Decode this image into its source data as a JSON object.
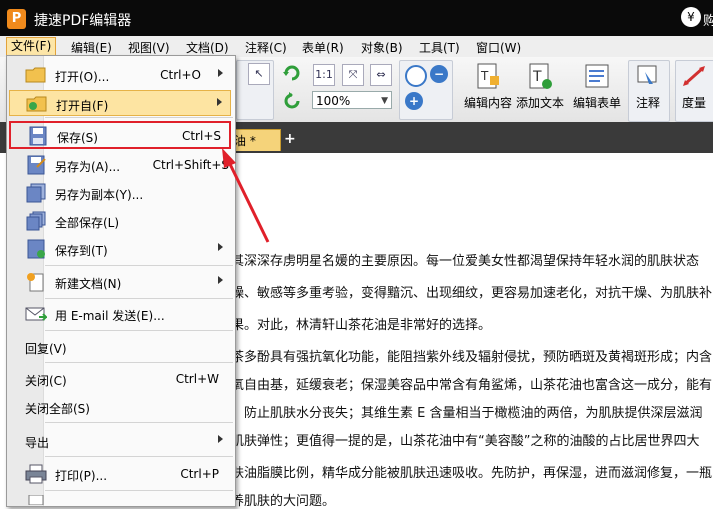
{
  "titlebar": {
    "logo_letter": "P",
    "title": "捷速PDF编辑器",
    "right_text": "购"
  },
  "menubar": {
    "file": "文件(F)",
    "edit": "编辑(E)",
    "view": "视图(V)",
    "document": "文档(D)",
    "comment": "注释(C)",
    "form": "表单(R)",
    "object": "对象(B)",
    "tools": "工具(T)",
    "window": "窗口(W)"
  },
  "toolbar": {
    "zoom_value": "100%",
    "edit_content": "编辑内容",
    "add_text": "添加文本",
    "edit_form": "编辑表单",
    "comment": "注释",
    "measure": "度量"
  },
  "tab": {
    "doc_title": "油 *"
  },
  "file_menu": {
    "open": {
      "label": "打开(O)...",
      "shortcut": "Ctrl+O"
    },
    "open_from": {
      "label": "打开自(F)"
    },
    "save": {
      "label": "保存(S)",
      "shortcut": "Ctrl+S"
    },
    "save_as": {
      "label": "另存为(A)...",
      "shortcut": "Ctrl+Shift+S"
    },
    "save_copy": {
      "label": "另存为副本(Y)..."
    },
    "save_all": {
      "label": "全部保存(L)"
    },
    "save_to": {
      "label": "保存到(T)"
    },
    "new_doc": {
      "label": "新建文档(N)"
    },
    "email": {
      "label": "用 E-mail 发送(E)..."
    },
    "revert": {
      "label": "回复(V)"
    },
    "close": {
      "label": "关闭(C)",
      "shortcut": "Ctrl+W"
    },
    "close_all": {
      "label": "关闭全部(S)"
    },
    "export": {
      "label": "导出"
    },
    "print": {
      "label": "打印(P)...",
      "shortcut": "Ctrl+P"
    }
  },
  "document_lines": [
    "其深深存虏明星名媛的主要原因。每一位爱美女性都渴望保持年轻水润的肌肤状态",
    "燥、敏感等多重考验，变得黯沉、出现细纹，更容易加速老化，对抗干燥、为肌肤补",
    "果。对此，林清轩山茶花油是非常好的选择。",
    "茶多酚具有强抗氧化功能，能阻挡紫外线及辐射侵扰，预防晒斑及黄褐斑形成；内含",
    "氧自由基，延缓衰老；保湿美容品中常含有角鲨烯，山茶花油也富含这一成分，能有",
    "，防止肌肤水分丧失；其维生素 E 含量相当于橄榄油的两倍，为肌肤提供深层滋润",
    "肌肤弹性；更值得一提的是，山茶花油中有“美容酸”之称的油酸的占比居世界四大",
    "肤油脂膜比例，精华成分能被肌肤迅速吸收。先防护，再保湿，进而滋润修复，一瓶",
    "养肌肤的大问题。"
  ],
  "colors": {
    "accent": "#fde4a2",
    "highlight_box": "#e0202a",
    "titlebar": "#0a0a0a",
    "tabstrip": "#3a3a3a"
  }
}
